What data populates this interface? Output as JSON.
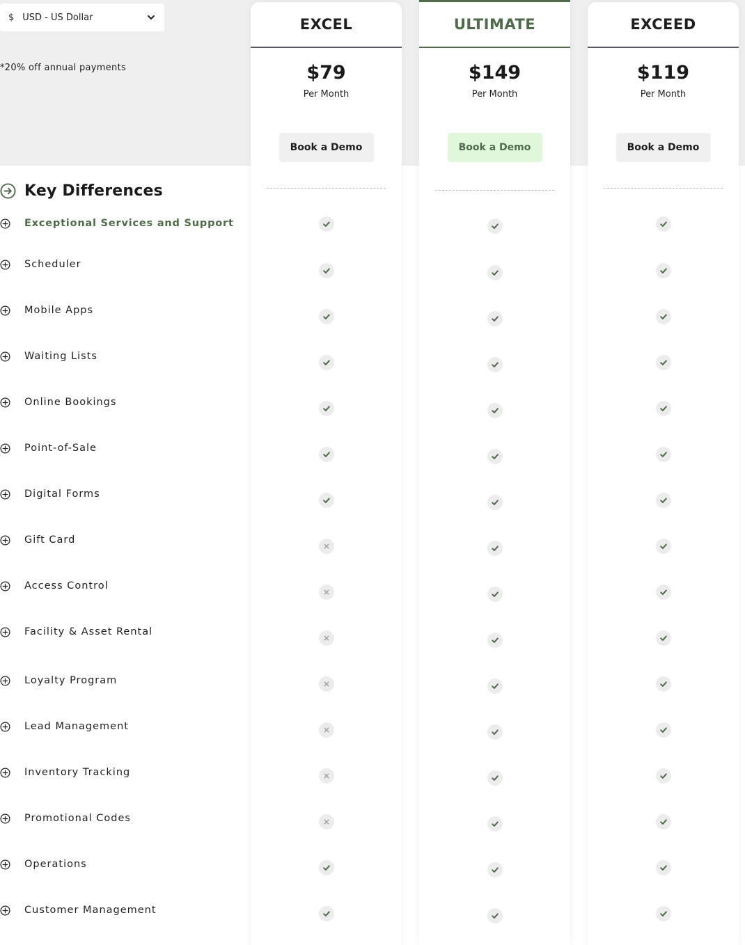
{
  "currency": {
    "symbol": "$",
    "label": "USD - US Dollar"
  },
  "discount_note": "*20% off annual payments",
  "key_differences_title": "Key Differences",
  "plans": [
    {
      "name": "EXCEL",
      "price": "$79",
      "period": "Per Month",
      "cta": "Book a Demo"
    },
    {
      "name": "ULTIMATE",
      "price": "$149",
      "period": "Per Month",
      "cta": "Book a Demo"
    },
    {
      "name": "EXCEED",
      "price": "$119",
      "period": "Per Month",
      "cta": "Book a Demo"
    }
  ],
  "features": [
    {
      "label": "Exceptional Services and Support",
      "included": [
        true,
        true,
        true
      ]
    },
    {
      "label": "Scheduler",
      "included": [
        true,
        true,
        true
      ]
    },
    {
      "label": "Mobile Apps",
      "included": [
        true,
        true,
        true
      ]
    },
    {
      "label": "Waiting Lists",
      "included": [
        true,
        true,
        true
      ]
    },
    {
      "label": "Online Bookings",
      "included": [
        true,
        true,
        true
      ]
    },
    {
      "label": "Point-of-Sale",
      "included": [
        true,
        true,
        true
      ]
    },
    {
      "label": "Digital Forms",
      "included": [
        true,
        true,
        true
      ]
    },
    {
      "label": "Gift Card",
      "included": [
        false,
        true,
        true
      ]
    },
    {
      "label": "Access Control",
      "included": [
        false,
        true,
        true
      ]
    },
    {
      "label": "Facility & Asset Rental",
      "included": [
        false,
        true,
        true
      ]
    },
    {
      "label": "Loyalty Program",
      "included": [
        false,
        true,
        true
      ]
    },
    {
      "label": "Lead Management",
      "included": [
        false,
        true,
        true
      ]
    },
    {
      "label": "Inventory Tracking",
      "included": [
        false,
        true,
        true
      ]
    },
    {
      "label": "Promotional Codes",
      "included": [
        false,
        true,
        true
      ]
    },
    {
      "label": "Operations",
      "included": [
        true,
        true,
        true
      ]
    },
    {
      "label": "Customer Management",
      "included": [
        true,
        true,
        true
      ]
    }
  ],
  "colors": {
    "accent": "#4f6b4a",
    "check": "#4f6b4a",
    "cross": "#a6a6a6",
    "featured_button_bg": "#e1f7dc",
    "top_band": "#efeff0"
  },
  "icons": {
    "expand": "plus-circle-icon",
    "section": "arrow-right-circle-icon",
    "dropdown": "chevron-down-icon"
  }
}
